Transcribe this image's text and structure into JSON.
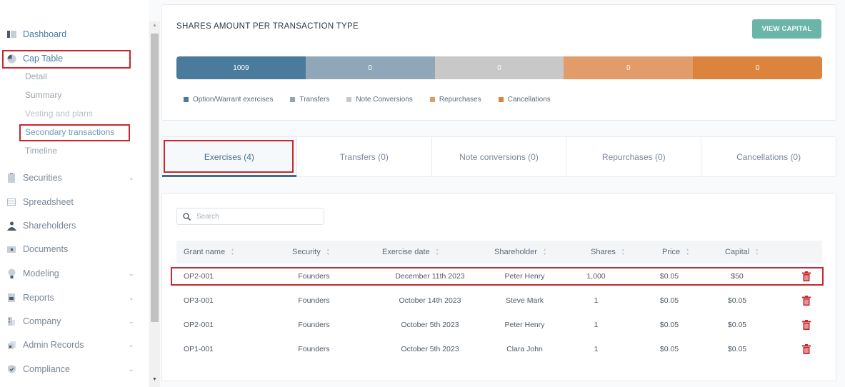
{
  "sidebar": {
    "items": [
      {
        "label": "Dashboard",
        "icon": "dashboard-icon"
      },
      {
        "label": "Cap Table",
        "icon": "pie-chart-icon",
        "expanded": true
      },
      {
        "label": "Securities",
        "icon": "clipboard-icon"
      },
      {
        "label": "Spreadsheet",
        "icon": "spreadsheet-icon"
      },
      {
        "label": "Shareholders",
        "icon": "person-icon"
      },
      {
        "label": "Documents",
        "icon": "folder-icon"
      },
      {
        "label": "Modeling",
        "icon": "lightbulb-icon"
      },
      {
        "label": "Reports",
        "icon": "report-icon"
      },
      {
        "label": "Company",
        "icon": "building-icon"
      },
      {
        "label": "Admin Records",
        "icon": "records-icon"
      },
      {
        "label": "Compliance",
        "icon": "shield-icon"
      }
    ],
    "captable_sub": [
      "Detail",
      "Summary",
      "Vesting and plans",
      "Secondary transactions",
      "Timeline"
    ]
  },
  "chart_card": {
    "title": "SHARES AMOUNT PER TRANSACTION TYPE",
    "view_capital_label": "VIEW CAPITAL"
  },
  "chart_data": {
    "type": "bar",
    "title": "SHARES AMOUNT PER TRANSACTION TYPE",
    "orientation": "horizontal-stacked",
    "categories": [
      "Option/Warrant exercises",
      "Transfers",
      "Note Conversions",
      "Repurchases",
      "Cancellations"
    ],
    "values": [
      1009,
      0,
      0,
      0,
      0
    ],
    "colors": [
      "#4a7b9d",
      "#8fa7b6",
      "#c8c8c8",
      "#e29c6a",
      "#dc843e"
    ],
    "legend": "bottom",
    "xlabel": "",
    "ylabel": ""
  },
  "tabs": [
    {
      "label": "Exercises (4)",
      "active": true
    },
    {
      "label": "Transfers (0)"
    },
    {
      "label": "Note conversions (0)"
    },
    {
      "label": "Repurchases (0)"
    },
    {
      "label": "Cancellations (0)"
    }
  ],
  "table": {
    "search_placeholder": "Search",
    "columns": [
      "Grant name",
      "Security",
      "Exercise date",
      "Shareholder",
      "Shares",
      "Price",
      "Capital"
    ],
    "rows": [
      [
        "OP2-001",
        "Founders",
        "December 11th 2023",
        "Peter Henry",
        "1,000",
        "$0.05",
        "$50"
      ],
      [
        "OP3-001",
        "Founders",
        "October 14th 2023",
        "Steve Mark",
        "1",
        "$0.05",
        "$0.05"
      ],
      [
        "OP2-001",
        "Founders",
        "October 5th 2023",
        "Peter Henry",
        "1",
        "$0.05",
        "$0.05"
      ],
      [
        "OP1-001",
        "Founders",
        "October 5th 2023",
        "Clara John",
        "1",
        "$0.05",
        "$0.05"
      ]
    ]
  },
  "colors": {
    "accent": "#4a7fa1",
    "button": "#6bb5a8",
    "delete": "#c9262d",
    "highlight_box": "#c9262d"
  }
}
